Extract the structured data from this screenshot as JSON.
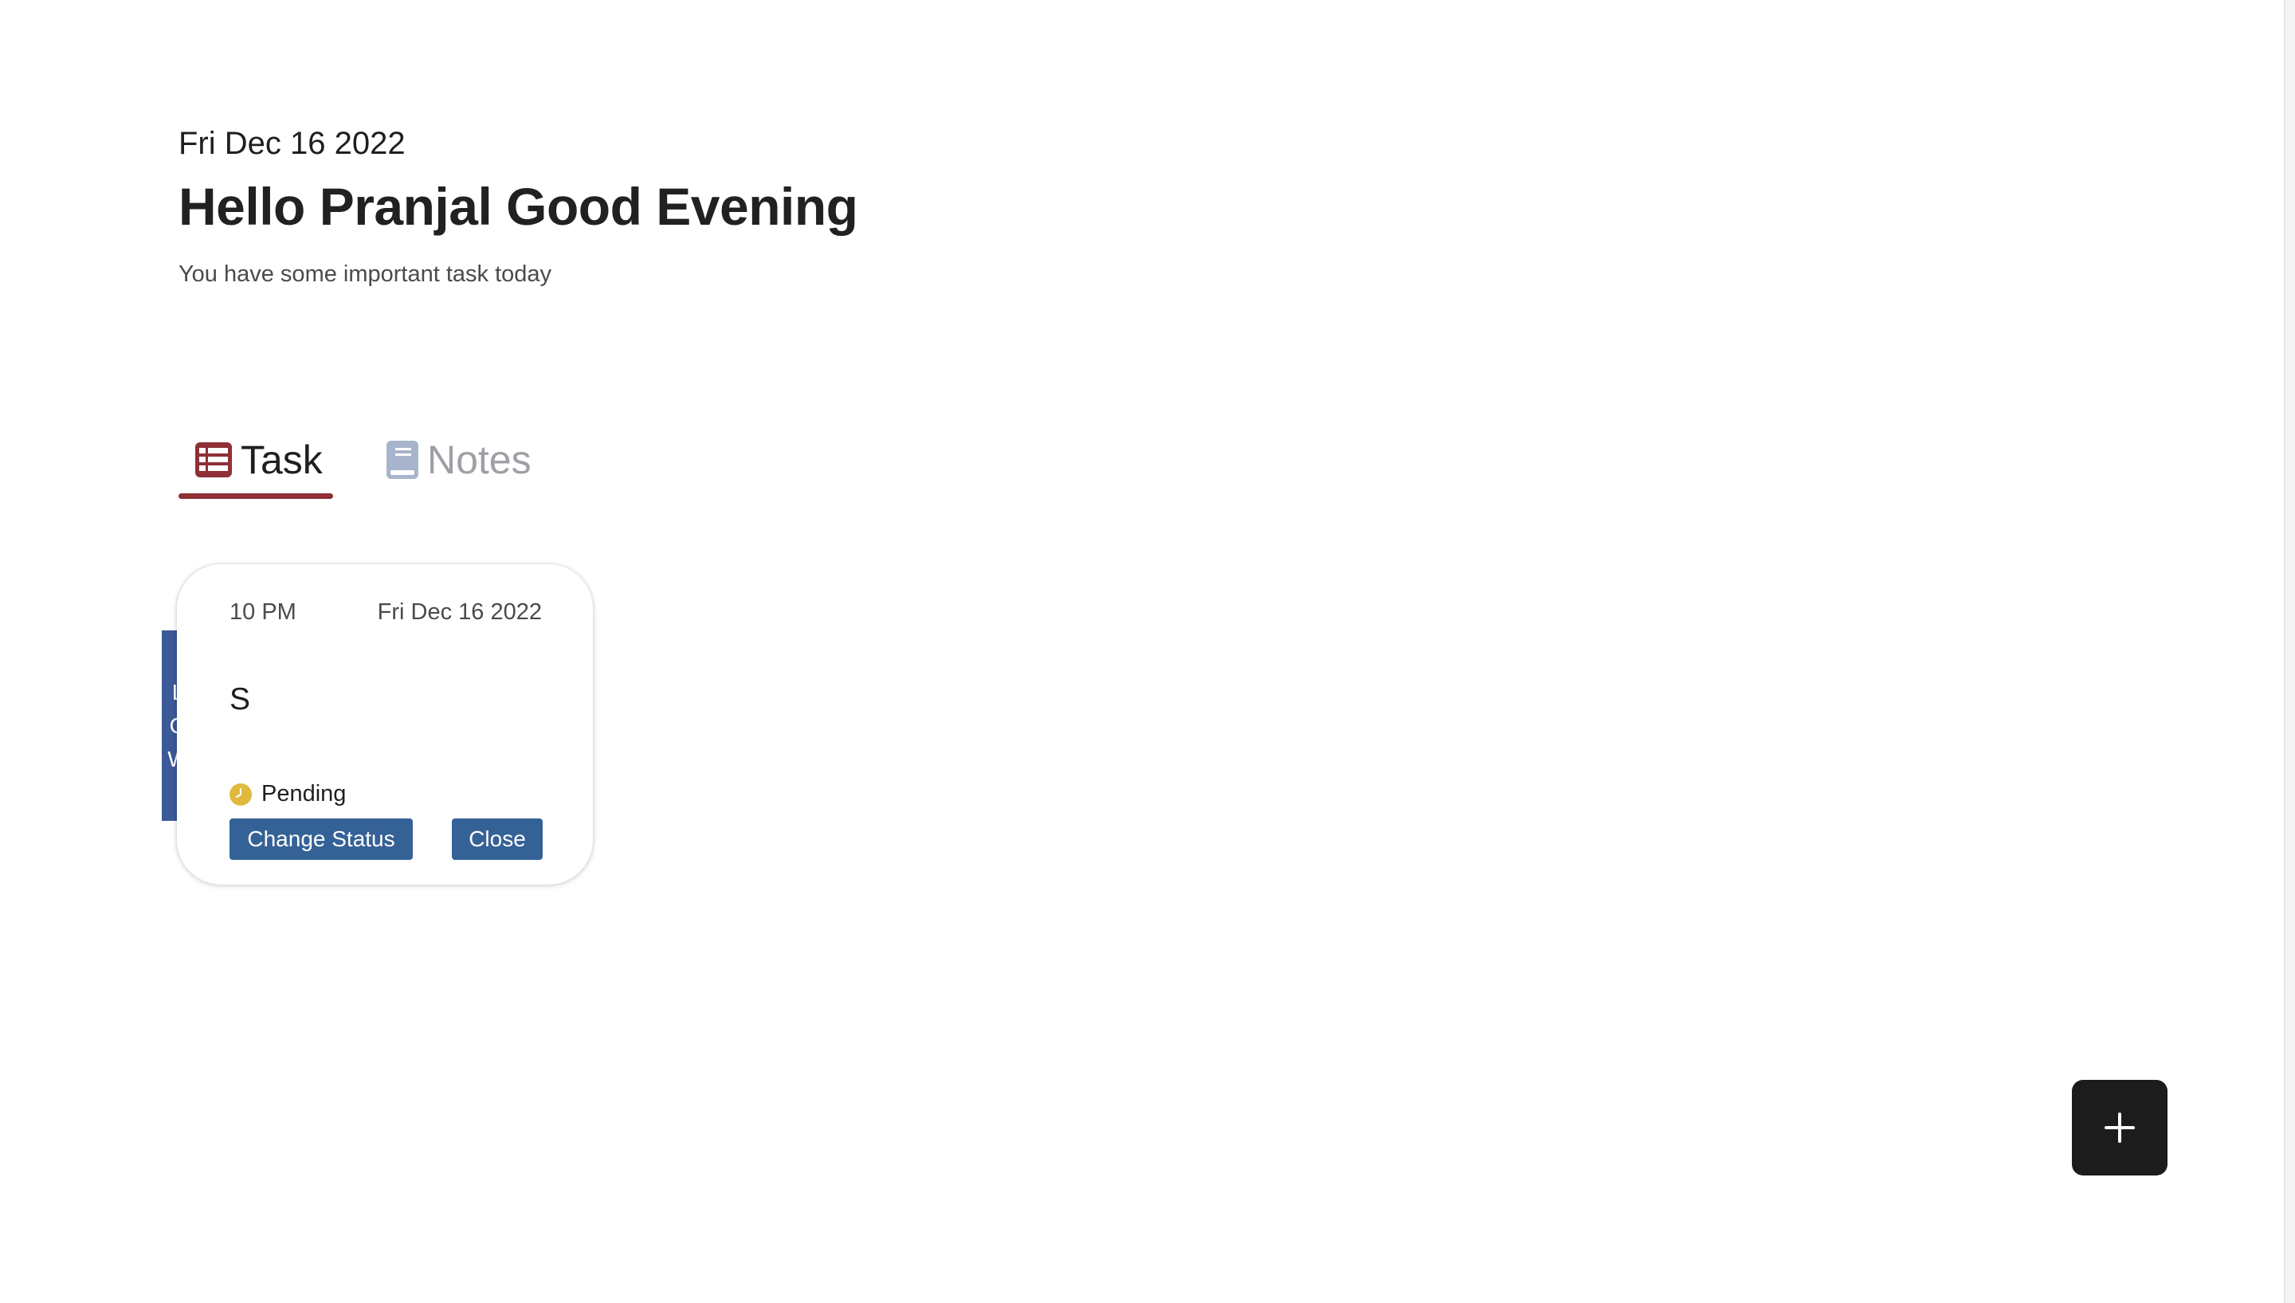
{
  "header": {
    "date": "Fri Dec 16 2022",
    "greeting": "Hello Pranjal Good Evening",
    "subtitle": "You have some important task today"
  },
  "tabs": [
    {
      "label": "Task",
      "icon": "task-list-icon",
      "active": true
    },
    {
      "label": "Notes",
      "icon": "notes-book-icon",
      "active": false
    }
  ],
  "task": {
    "priority": "LOW",
    "time": "10 PM",
    "date": "Fri Dec 16 2022",
    "title": "S",
    "status": "Pending",
    "status_icon": "clock-icon",
    "change_status_label": "Change Status",
    "close_label": "Close"
  },
  "fab": {
    "icon": "plus-icon"
  },
  "colors": {
    "accent": "#8f2f36",
    "priority_low": "#3c5a98",
    "button": "#356296",
    "pending": "#e1b93c",
    "fab": "#1c1c1c"
  }
}
